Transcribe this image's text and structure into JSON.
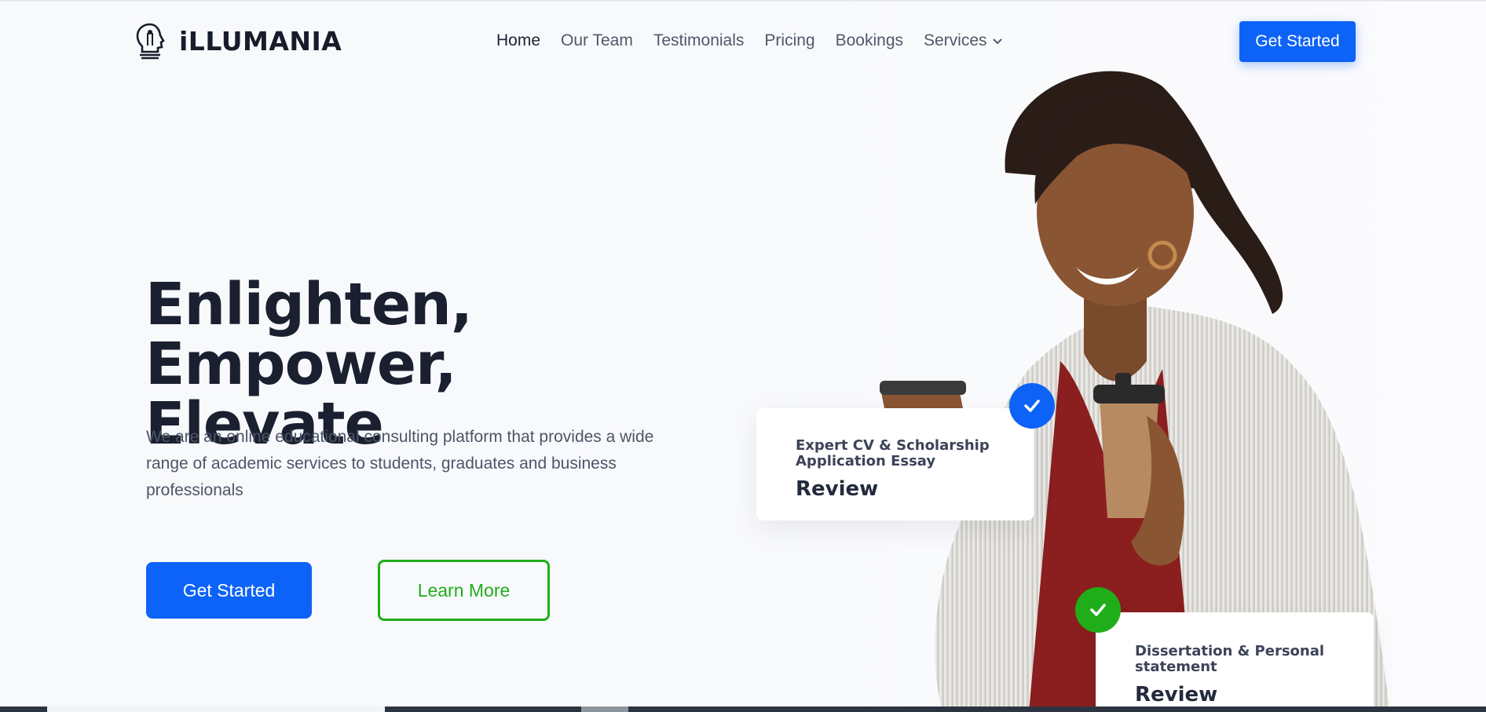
{
  "brand": {
    "name": "iLLUMANIA"
  },
  "nav": {
    "items": [
      {
        "label": "Home"
      },
      {
        "label": "Our Team"
      },
      {
        "label": "Testimonials"
      },
      {
        "label": "Pricing"
      },
      {
        "label": "Bookings"
      },
      {
        "label": "Services"
      }
    ],
    "cta_label": "Get Started"
  },
  "hero": {
    "title_line1": "Enlighten, Empower,",
    "title_line2": "Elevate",
    "description": "We are an online educational consulting platform that provides a wide range of academic services to students, graduates and business professionals",
    "primary_button": "Get Started",
    "secondary_button": "Learn More"
  },
  "cards": [
    {
      "subtitle": "Expert CV & Scholarship Application Essay",
      "title": "Review"
    },
    {
      "subtitle": "Dissertation & Personal statement",
      "title": "Review"
    }
  ],
  "colors": {
    "primary": "#0d63f8",
    "accent_green": "#1fae19",
    "heading": "#1b2030",
    "text": "#4d5567"
  },
  "icons": [
    "lightbulb-head-logo-icon",
    "chevron-down-icon",
    "check-icon",
    "check-icon"
  ]
}
